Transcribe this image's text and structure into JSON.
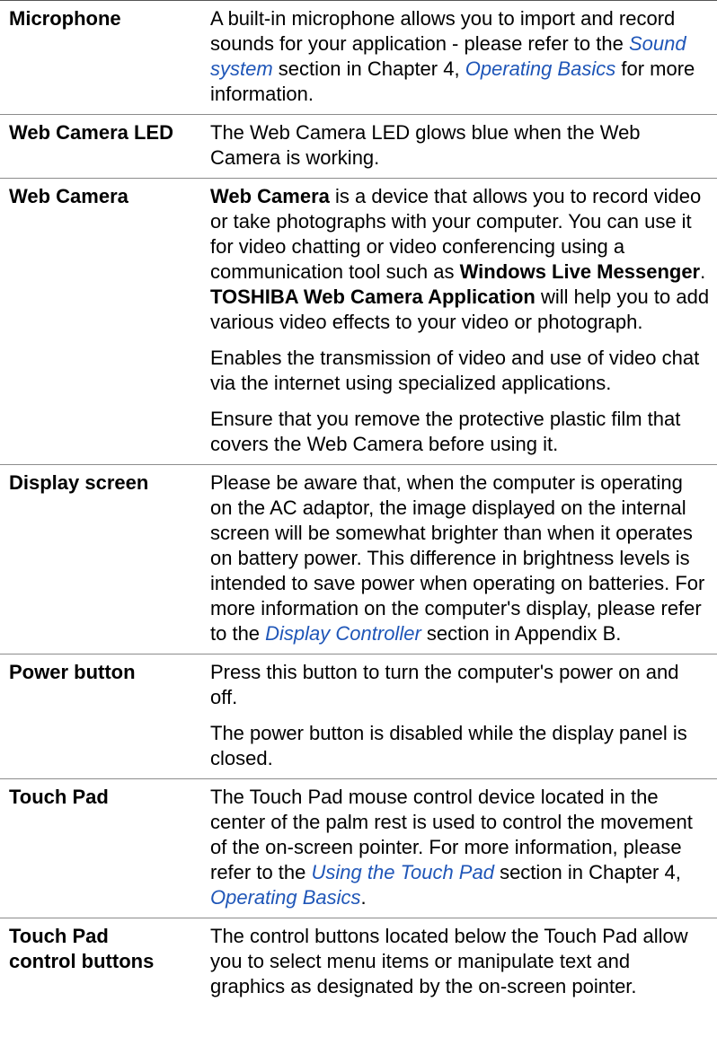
{
  "colors": {
    "link": "#1f56b8",
    "rule": "#8c8c8c"
  },
  "rows": [
    {
      "term": "Microphone",
      "p1": {
        "a": "A built-in microphone allows you to import and record sounds for your application - please refer to the ",
        "link1": "Sound system",
        "b": " section in Chapter 4, ",
        "link2": "Operating Basics",
        "c": " for more information."
      }
    },
    {
      "term": "Web Camera LED",
      "p1": "The Web Camera LED glows blue when the Web Camera is working."
    },
    {
      "term": "Web Camera",
      "p1": {
        "b1": "Web Camera",
        "t1": " is a device that allows you to record video or take photographs with your computer. You can use it for video chatting or video conferencing using a communication tool such as ",
        "b2": "Windows Live Messenger",
        "t2": ". ",
        "b3": "TOSHIBA Web Camera Application",
        "t3": " will help you to add various video effects to your video or photograph."
      },
      "p2": "Enables the transmission of video and use of video chat via the internet using specialized applications.",
      "p3": "Ensure that you remove the protective plastic film that covers the Web Camera before using it."
    },
    {
      "term": "Display screen",
      "p1": {
        "a": "Please be aware that, when the computer is operating on the AC adaptor, the image displayed on the internal screen will be somewhat brighter than when it operates on battery power. This difference in brightness levels is intended to save power when operating on batteries. For more information on the computer's display, please refer to the ",
        "link": "Display Controller",
        "b": " section in Appendix B."
      }
    },
    {
      "term": "Power button",
      "p1": "Press this button to turn the computer's power on and off.",
      "p2": "The power button is disabled while the display panel is closed."
    },
    {
      "term": "Touch Pad",
      "p1": {
        "a": "The Touch Pad mouse control device located in the center of the palm rest is used to control the movement of the on-screen pointer. For more information, please refer to the ",
        "link1": "Using the Touch Pad",
        "b": " section in Chapter 4, ",
        "link2": "Operating Basics",
        "c": "."
      }
    },
    {
      "term": "Touch Pad control buttons",
      "p1": "The control buttons located below the Touch Pad allow you to select menu items or manipulate text and graphics as designated by the on-screen pointer."
    }
  ]
}
